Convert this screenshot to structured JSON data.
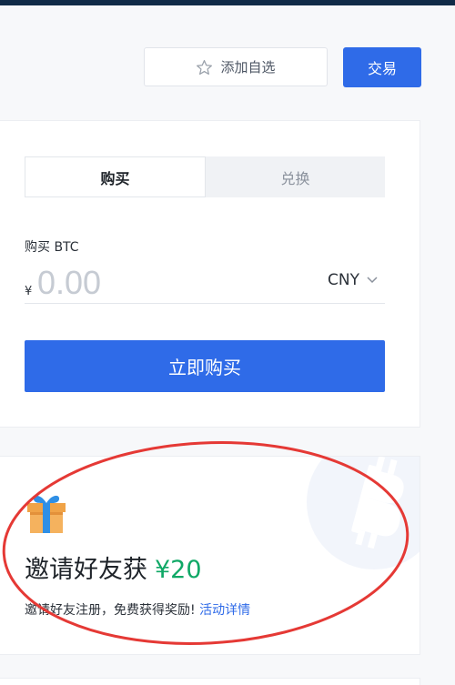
{
  "header": {
    "watchlist_label": "添加自选",
    "trade_label": "交易"
  },
  "buy": {
    "tabs": [
      {
        "label": "购买",
        "active": true
      },
      {
        "label": "兑换",
        "active": false
      }
    ],
    "amount_label": "购买 BTC",
    "currency_symbol": "¥",
    "amount_placeholder": "0.00",
    "currency": "CNY",
    "buy_now_label": "立即购买"
  },
  "invite": {
    "title": "邀请好友获",
    "reward": "¥20",
    "description": "邀请好友注册，免费获得奖励!",
    "link_label": "活动详情"
  },
  "colors": {
    "primary": "#2f6be8",
    "reward_green": "#0fa866",
    "annotation_red": "#e53935",
    "top_bar": "#102b47"
  }
}
